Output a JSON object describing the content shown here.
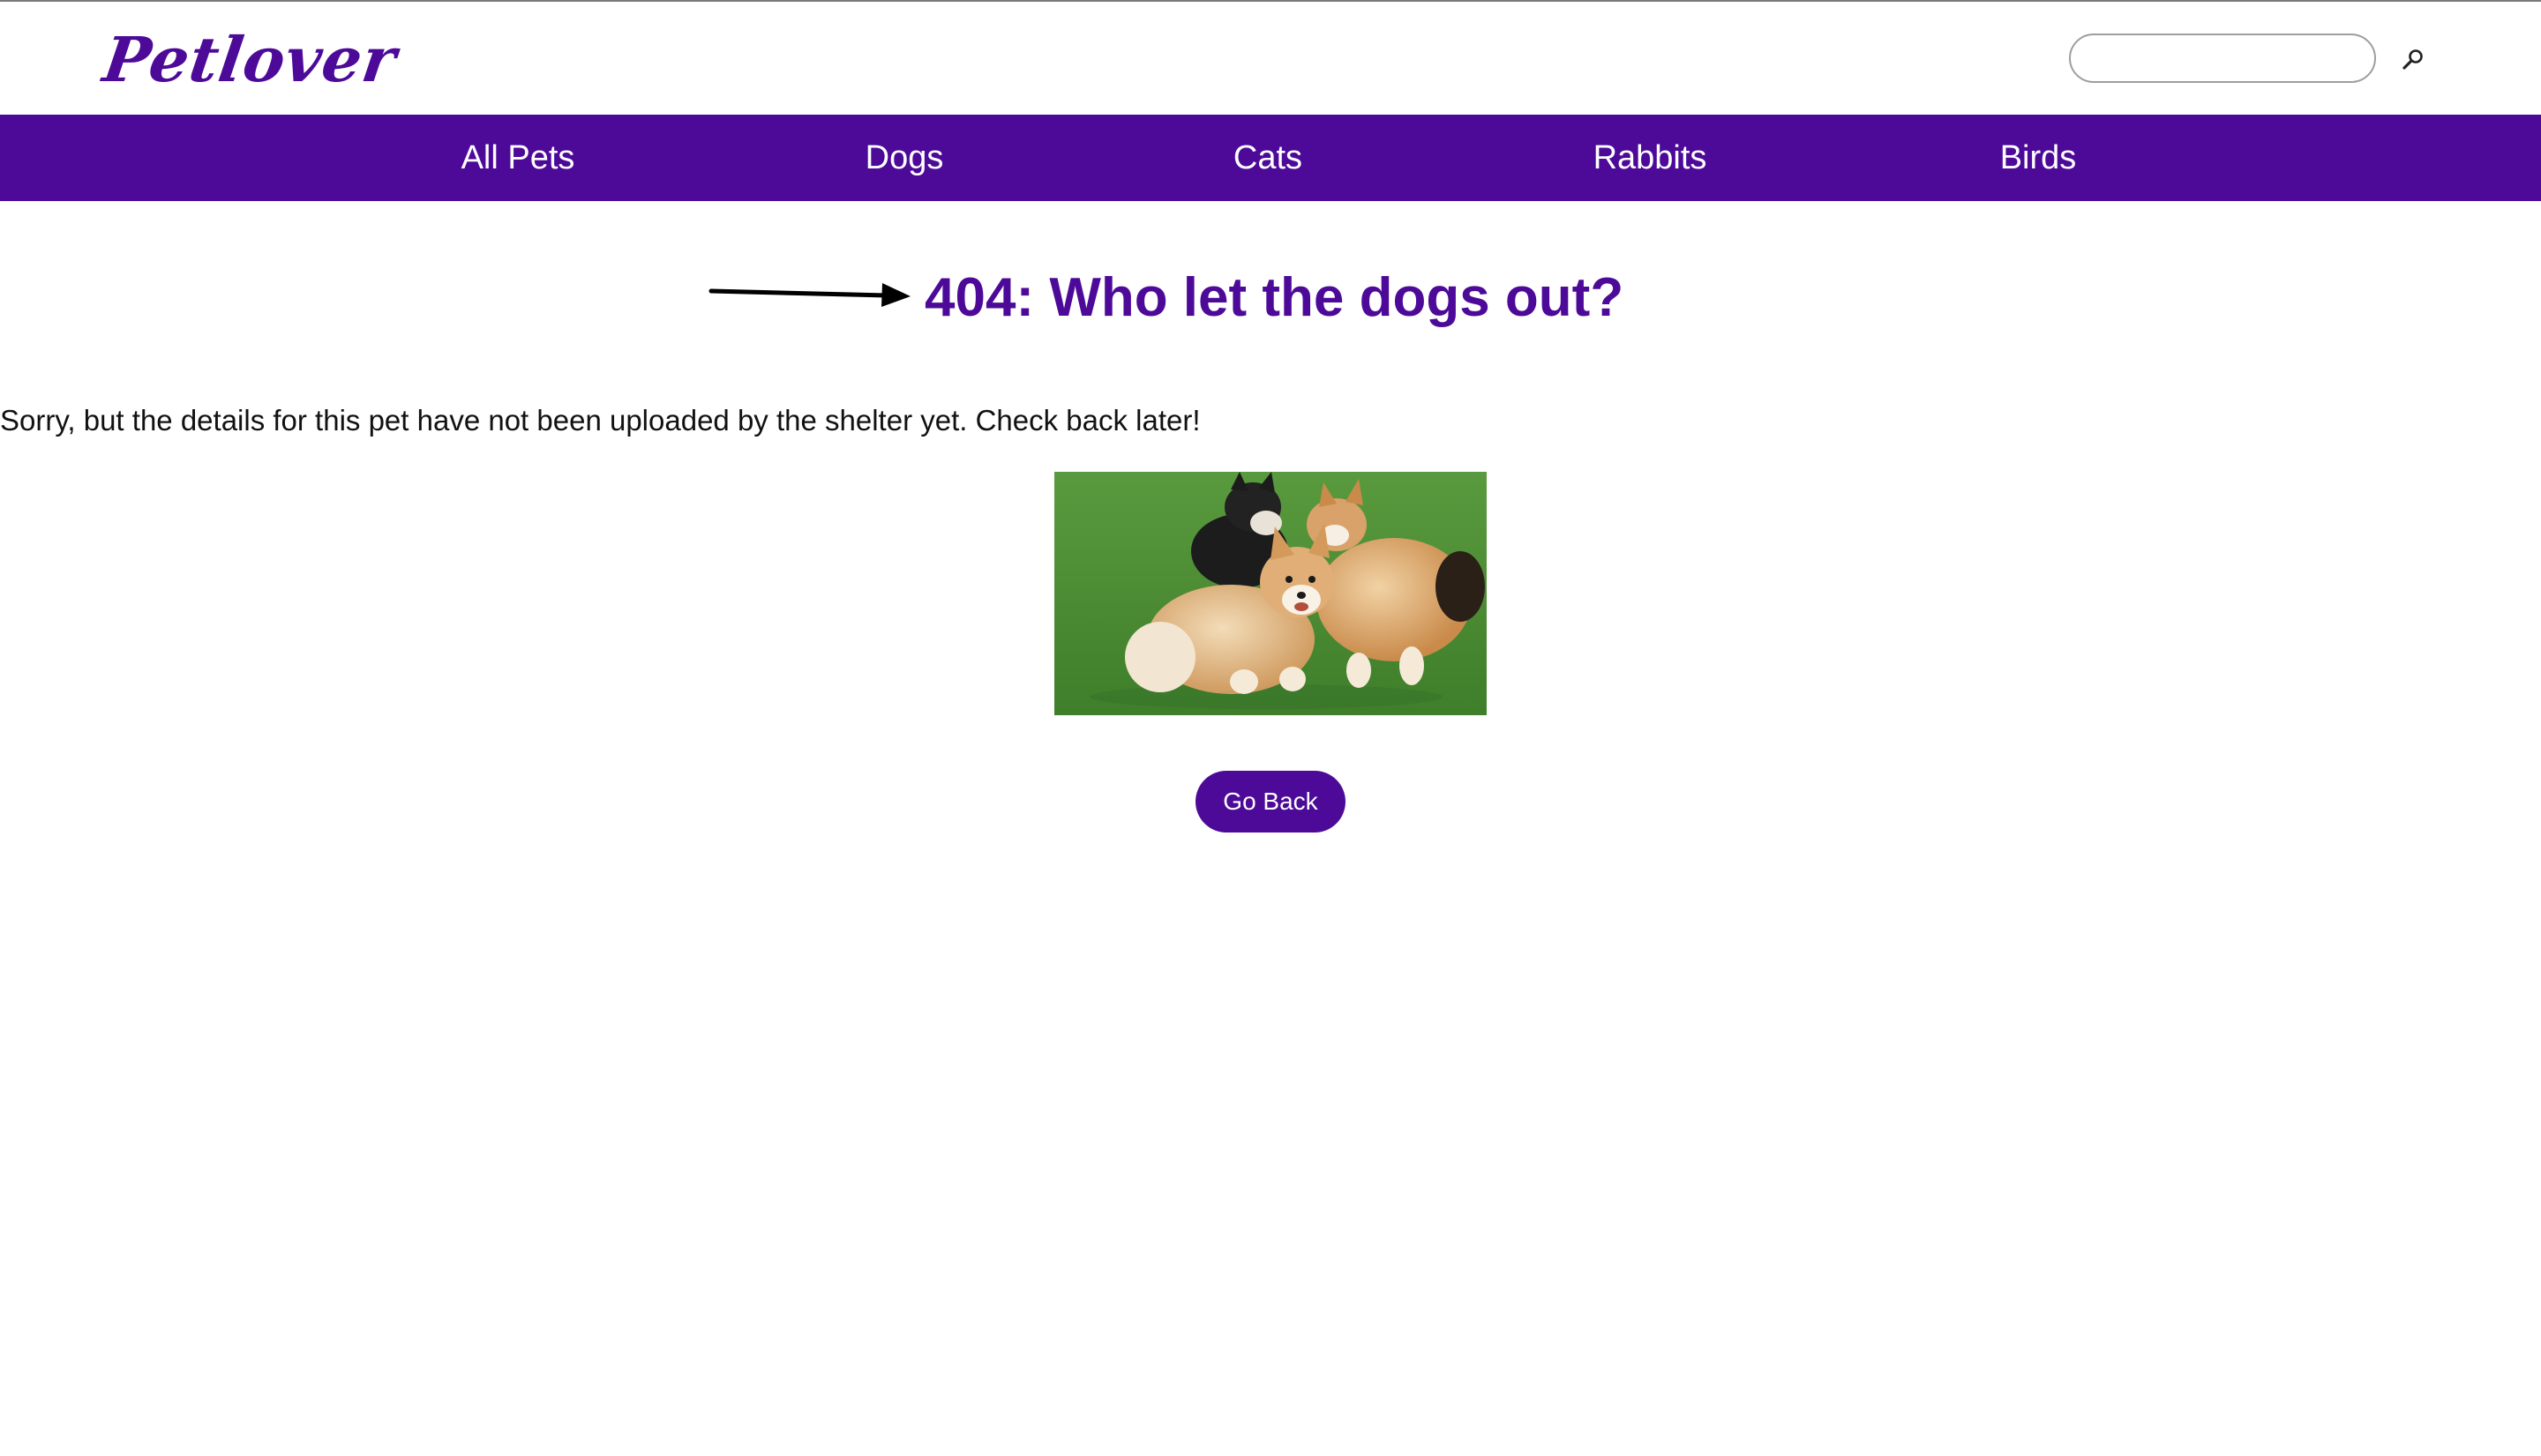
{
  "header": {
    "logo_text": "Petlover",
    "search": {
      "placeholder": "",
      "value": "",
      "button_icon": "search-magnifier-icon"
    }
  },
  "nav": {
    "items": [
      {
        "label": "All Pets"
      },
      {
        "label": "Dogs"
      },
      {
        "label": "Cats"
      },
      {
        "label": "Rabbits"
      },
      {
        "label": "Birds"
      }
    ]
  },
  "main": {
    "arrow_icon": "right-arrow-icon",
    "title": "404: Who let the dogs out?",
    "message": "Sorry, but the details for this pet have not been uploaded by the shelter yet. Check back later!",
    "image_subject": "corgi-dogs-playing-on-grass",
    "go_back_label": "Go Back"
  },
  "colors": {
    "brand_purple": "#4d0a99",
    "nav_text": "#ffffff",
    "body_text": "#111111",
    "background": "#ffffff"
  }
}
